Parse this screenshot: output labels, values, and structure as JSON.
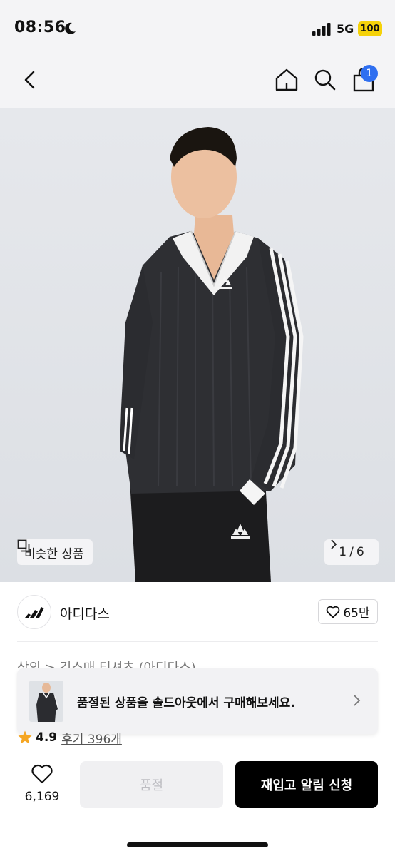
{
  "status_bar": {
    "time": "08:56",
    "network": "5G",
    "battery": "100"
  },
  "nav": {
    "cart_count": "1"
  },
  "hero": {
    "similar_label": "비슷한 상품",
    "page_current": "1",
    "page_sep": "/",
    "page_total": "6"
  },
  "brand": {
    "name": "아디다스",
    "likes": "65만"
  },
  "breadcrumb": "상의 > 긴소매 티셔츠 (아디다스)",
  "banner": {
    "text": "품절된 상품을 솔드아웃에서 구매해보세요."
  },
  "rating": {
    "score": "4.9",
    "reviews": "후기 396개"
  },
  "actions": {
    "wish_count": "6,169",
    "soldout_label": "품절",
    "restock_label": "재입고 알림 신청"
  }
}
